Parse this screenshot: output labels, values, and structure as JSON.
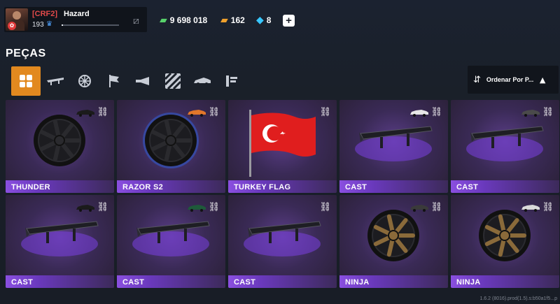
{
  "player": {
    "crew_tag": "[CRF2]",
    "name": "Hazard",
    "level": "193",
    "xp_progress_fraction": 0.02
  },
  "currencies": {
    "cash": "9 698 018",
    "gold": "162",
    "gems": "8",
    "add_label": "+"
  },
  "page": {
    "title": "PEÇAS",
    "sort_label": "Ordenar Por P..."
  },
  "tabs": [
    {
      "icon": "grid-icon",
      "active": true
    },
    {
      "icon": "spoiler-icon",
      "active": false
    },
    {
      "icon": "rim-icon",
      "active": false
    },
    {
      "icon": "flag-icon",
      "active": false
    },
    {
      "icon": "horn-icon",
      "active": false
    },
    {
      "icon": "pattern-icon",
      "active": false
    },
    {
      "icon": "car-body-icon",
      "active": false
    },
    {
      "icon": "exhaust-icon",
      "active": false
    }
  ],
  "items": [
    {
      "name": "THUNDER",
      "type": "wheel",
      "rim": "#2a2a2e",
      "car": "#1b1b1b"
    },
    {
      "name": "RAZOR S2",
      "type": "wheel",
      "rim": "#2a2a2e",
      "car": "#e0762a",
      "glow": "#2f5fd6"
    },
    {
      "name": "TURKEY FLAG",
      "type": "flag",
      "car": ""
    },
    {
      "name": "CAST",
      "type": "spoiler",
      "car": "#e6e6e6"
    },
    {
      "name": "CAST",
      "type": "spoiler",
      "car": "#4a4a4a"
    },
    {
      "name": "CAST",
      "type": "spoiler",
      "car": "#1b1b1b"
    },
    {
      "name": "CAST",
      "type": "spoiler",
      "car": "#1e5a3a"
    },
    {
      "name": "CAST",
      "type": "spoiler",
      "car": ""
    },
    {
      "name": "NINJA",
      "type": "wheel",
      "rim": "#8a6a3a",
      "car": "#3a3a3a"
    },
    {
      "name": "NINJA",
      "type": "wheel",
      "rim": "#8a6a3a",
      "car": "#d9d9d9"
    }
  ],
  "version_text": "1.6.2 (8016).prod(1.5).s:b50a1f5...p",
  "colors": {
    "accent": "#e2891f",
    "card_purple": "#5a3d87",
    "label_purple": "#8a4fe0"
  }
}
